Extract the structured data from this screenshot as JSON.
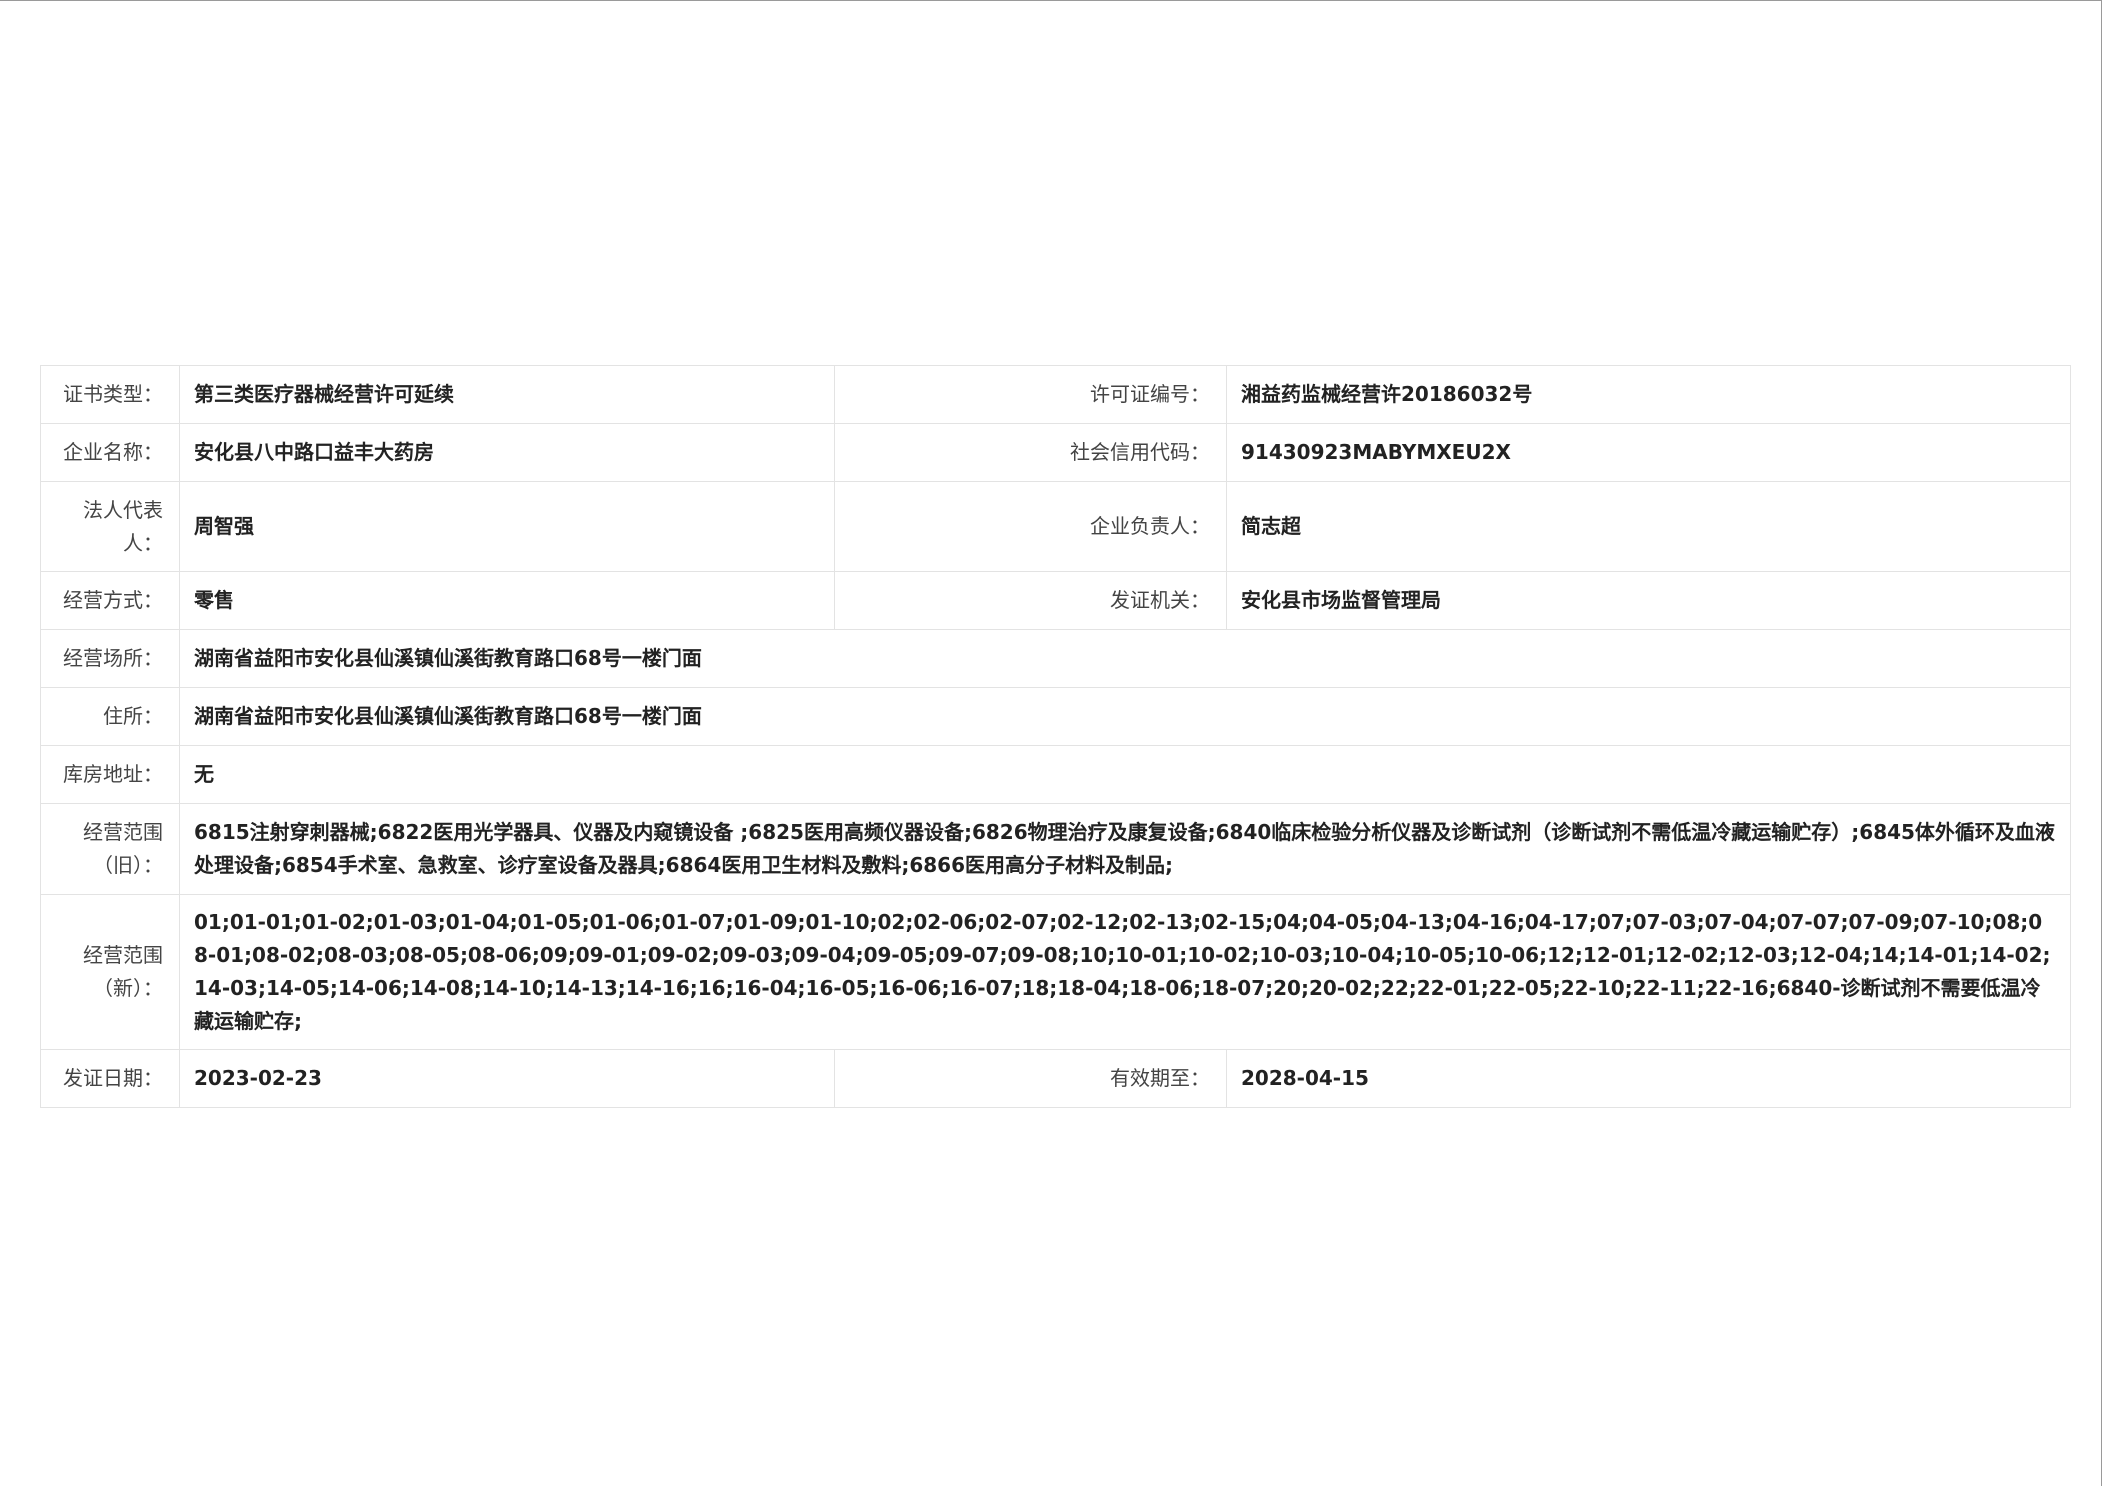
{
  "license": {
    "cert_type_label": "证书类型：",
    "cert_type_value": "第三类医疗器械经营许可延续",
    "license_no_label": "许可证编号：",
    "license_no_value": "湘益药监械经营许20186032号",
    "company_name_label": "企业名称：",
    "company_name_value": "安化县八中路口益丰大药房",
    "credit_code_label": "社会信用代码：",
    "credit_code_value": "91430923MABYMXEU2X",
    "legal_rep_label": "法人代表人：",
    "legal_rep_value": "周智强",
    "principal_label": "企业负责人：",
    "principal_value": "简志超",
    "business_mode_label": "经营方式：",
    "business_mode_value": "零售",
    "issuer_label": "发证机关：",
    "issuer_value": "安化县市场监督管理局",
    "premises_label": "经营场所：",
    "premises_value": "湖南省益阳市安化县仙溪镇仙溪街教育路口68号一楼门面",
    "residence_label": "住所：",
    "residence_value": "湖南省益阳市安化县仙溪镇仙溪街教育路口68号一楼门面",
    "warehouse_label": "库房地址：",
    "warehouse_value": "无",
    "scope_old_label": "经营范围（旧）：",
    "scope_old_value": "6815注射穿刺器械;6822医用光学器具、仪器及内窥镜设备 ;6825医用高频仪器设备;6826物理治疗及康复设备;6840临床检验分析仪器及诊断试剂（诊断试剂不需低温冷藏运输贮存）;6845体外循环及血液处理设备;6854手术室、急救室、诊疗室设备及器具;6864医用卫生材料及敷料;6866医用高分子材料及制品;",
    "scope_new_label": "经营范围（新）：",
    "scope_new_value": "01;01-01;01-02;01-03;01-04;01-05;01-06;01-07;01-09;01-10;02;02-06;02-07;02-12;02-13;02-15;04;04-05;04-13;04-16;04-17;07;07-03;07-04;07-07;07-09;07-10;08;08-01;08-02;08-03;08-05;08-06;09;09-01;09-02;09-03;09-04;09-05;09-07;09-08;10;10-01;10-02;10-03;10-04;10-05;10-06;12;12-01;12-02;12-03;12-04;14;14-01;14-02;14-03;14-05;14-06;14-08;14-10;14-13;14-16;16;16-04;16-05;16-06;16-07;18;18-04;18-06;18-07;20;20-02;22;22-01;22-05;22-10;22-11;22-16;6840-诊断试剂不需要低温冷藏运输贮存;",
    "issue_date_label": "发证日期：",
    "issue_date_value": "2023-02-23",
    "valid_until_label": "有效期至：",
    "valid_until_value": "2028-04-15"
  }
}
